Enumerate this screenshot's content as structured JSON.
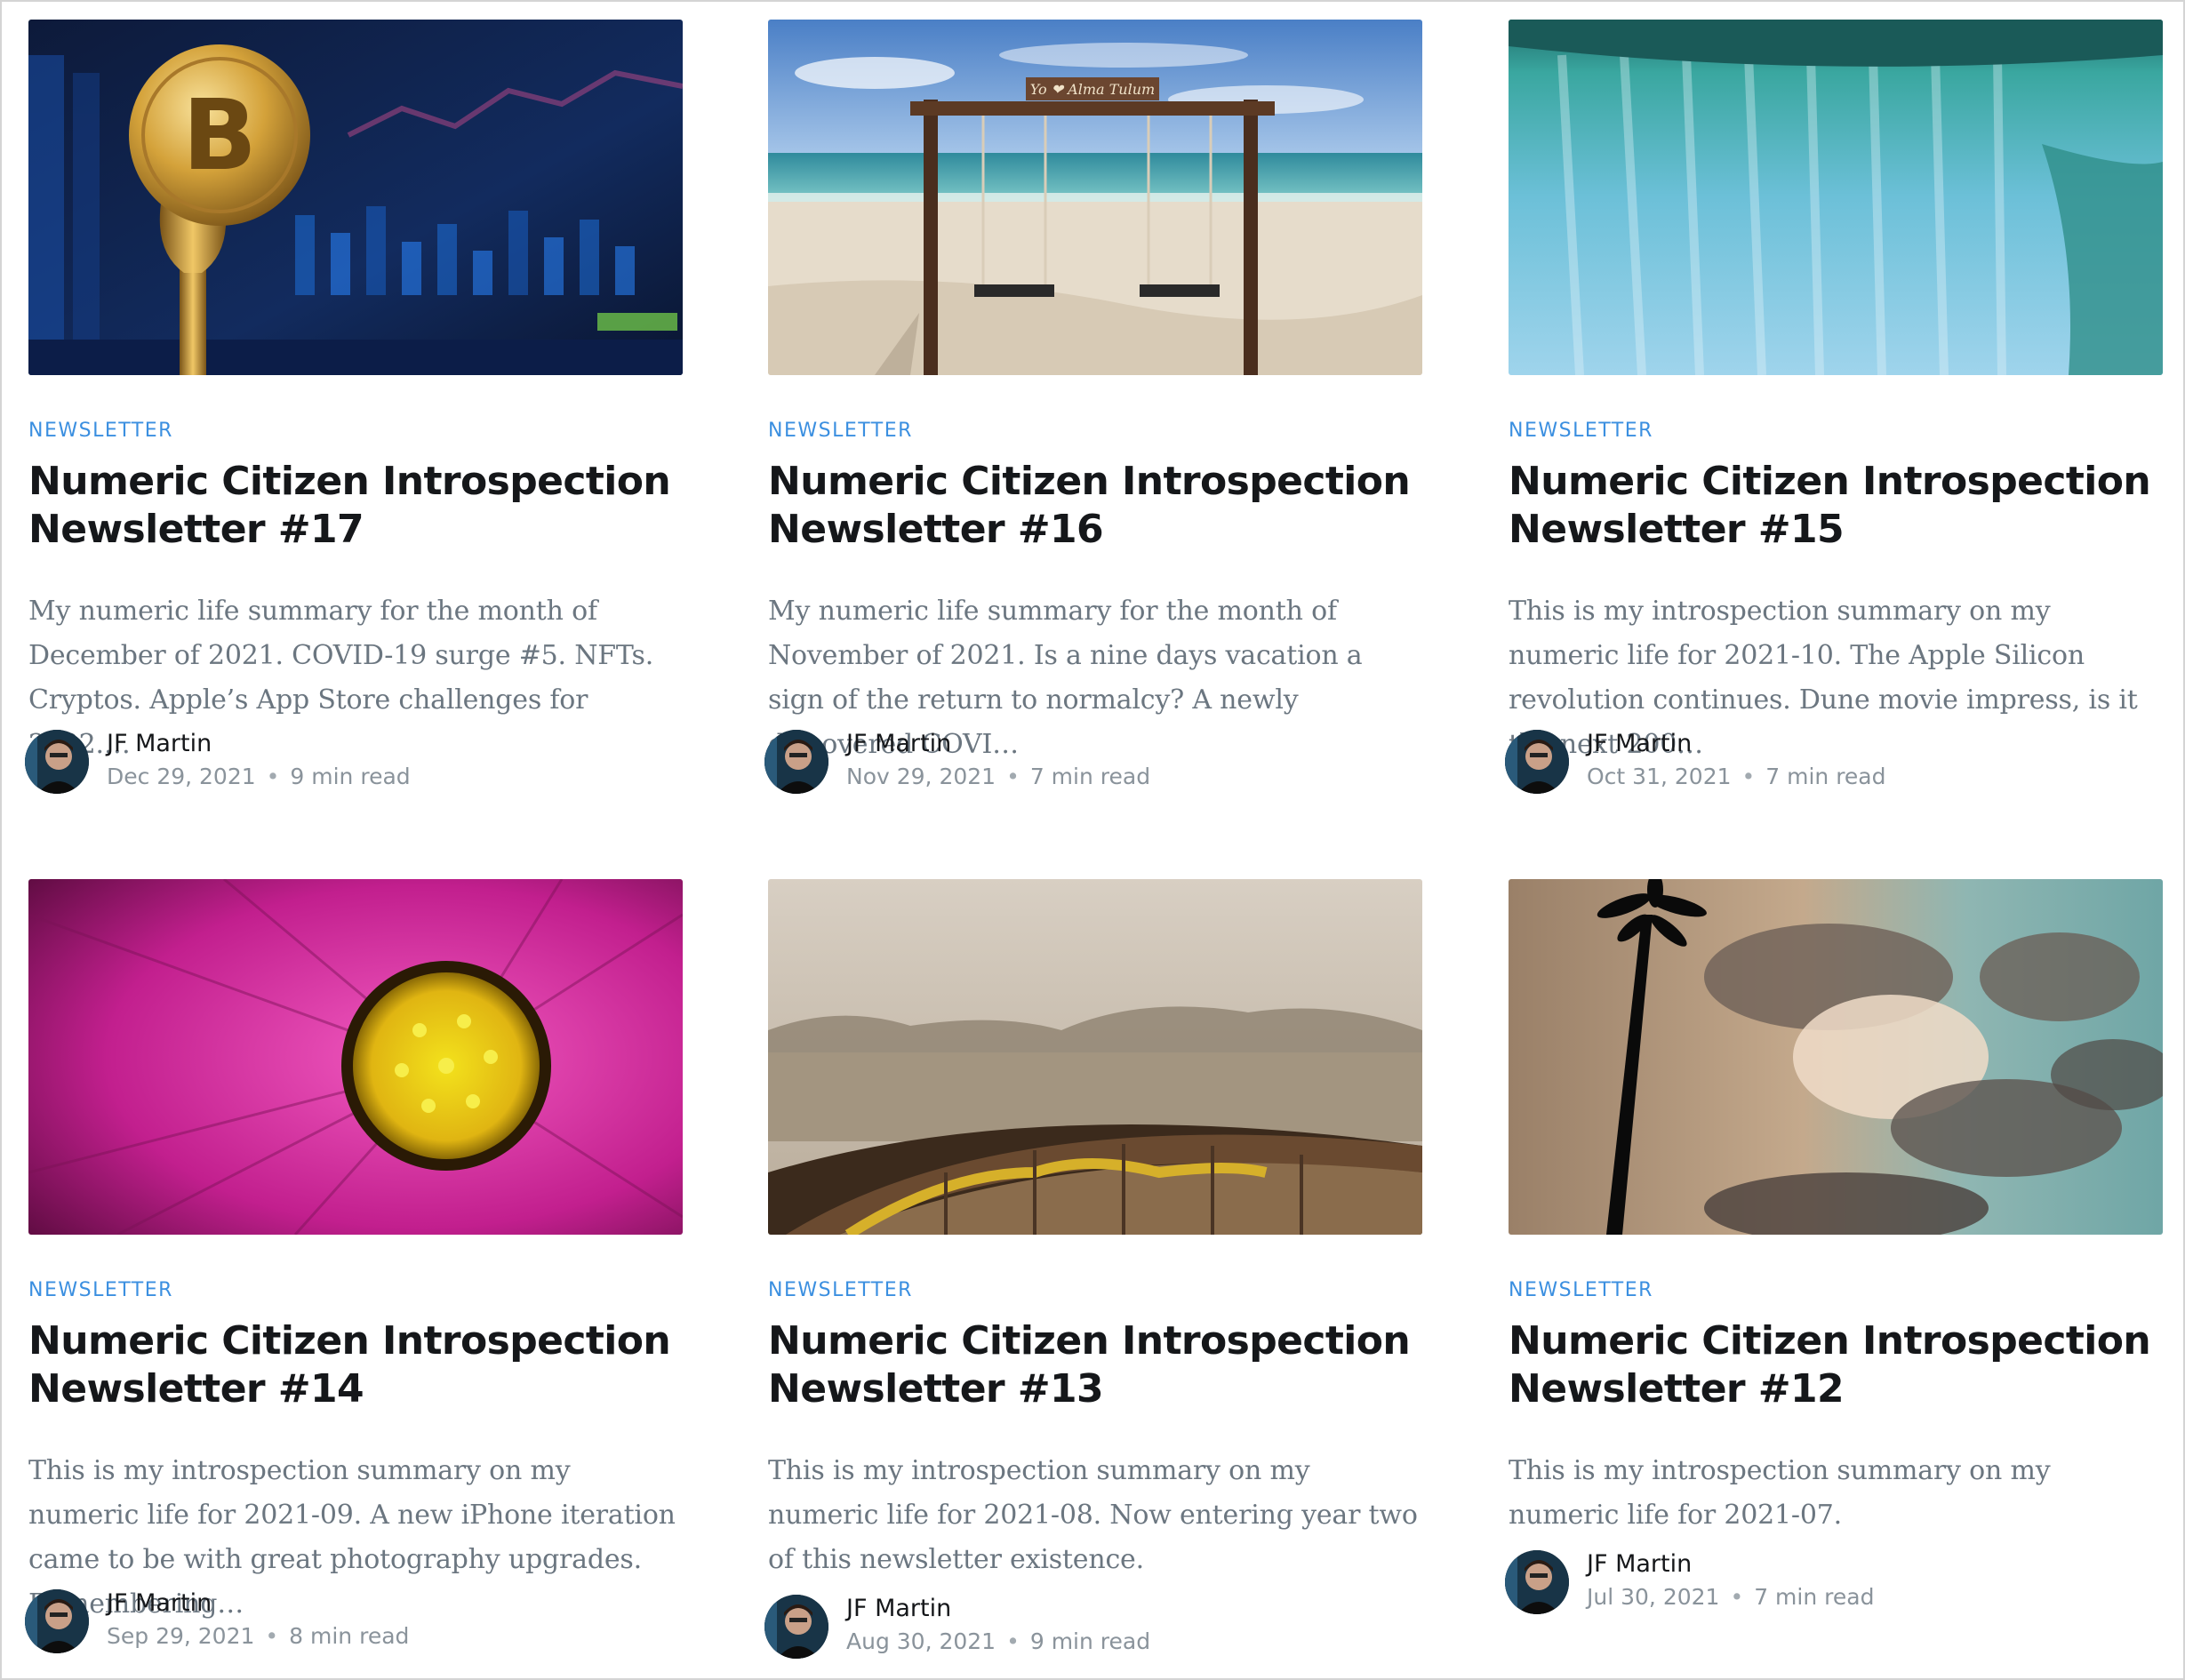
{
  "posts": [
    {
      "tag": "NEWSLETTER",
      "title": "Numeric Citizen Introspection Newsletter #17",
      "excerpt": "My numeric life summary for the month of December of 2021. COVID-19 surge #5. NFTs. Cryptos. Apple’s App Store challenges for 2022.…",
      "author": "JF Martin",
      "date": "Dec 29, 2021",
      "read_time": "9 min read",
      "image": "bitcoin-coin-photo"
    },
    {
      "tag": "NEWSLETTER",
      "title": "Numeric Citizen Introspection Newsletter #16",
      "excerpt": "My numeric life summary for the month of November of 2021. Is a nine days vacation a sign of the return to normalcy? A newly discovered COVI…",
      "author": "JF Martin",
      "date": "Nov 29, 2021",
      "read_time": "7 min read",
      "image": "beach-swing-photo",
      "image_sign": "Yo ❤ Alma Tulum"
    },
    {
      "tag": "NEWSLETTER",
      "title": "Numeric Citizen Introspection Newsletter #15",
      "excerpt": "This is my introspection summary on my numeric life for 2021-10. The Apple Silicon revolution continues. Dune movie impress, is it the next 200…",
      "author": "JF Martin",
      "date": "Oct 31, 2021",
      "read_time": "7 min read",
      "image": "waterfall-photo"
    },
    {
      "tag": "NEWSLETTER",
      "title": "Numeric Citizen Introspection Newsletter #14",
      "excerpt": "This is my introspection summary on my numeric life for 2021-09. A new iPhone iteration came to be with great photography upgrades. Remembering…",
      "author": "JF Martin",
      "date": "Sep 29, 2021",
      "read_time": "8 min read",
      "image": "pink-flower-photo"
    },
    {
      "tag": "NEWSLETTER",
      "title": "Numeric Citizen Introspection Newsletter #13",
      "excerpt": "This is my introspection summary on my numeric life for 2021-08. Now entering year two of this newsletter existence.",
      "author": "JF Martin",
      "date": "Aug 30, 2021",
      "read_time": "9 min read",
      "image": "old-boat-photo"
    },
    {
      "tag": "NEWSLETTER",
      "title": "Numeric Citizen Introspection Newsletter #12",
      "excerpt": "This is my introspection summary on my numeric life for 2021-07.",
      "author": "JF Martin",
      "date": "Jul 30, 2021",
      "read_time": "7 min read",
      "image": "palm-tree-clouds-photo"
    }
  ],
  "colors": {
    "tag": "#3b8fe0",
    "title": "#15171a",
    "excerpt": "#6b7680",
    "meta": "#8a939b"
  }
}
